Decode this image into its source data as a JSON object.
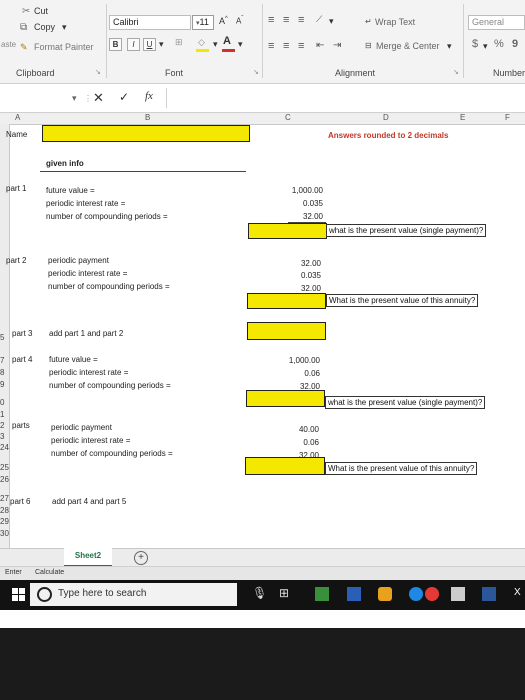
{
  "ribbon": {
    "cut": "Cut",
    "copy": "Copy",
    "paste_partial": "aste",
    "format_painter": "Format Painter",
    "font_name": "Calibri",
    "font_size": "11",
    "grow_font": "A",
    "shrink_font": "A",
    "bold": "B",
    "italic": "I",
    "underline": "U",
    "font_color": "A",
    "wrap_text": "Wrap Text",
    "merge_center": "Merge & Center",
    "number_format": "General",
    "currency": "$",
    "percent": "%",
    "comma": "9",
    "groups": {
      "clipboard": "Clipboard",
      "font": "Font",
      "alignment": "Alignment",
      "number": "Number"
    }
  },
  "formula_bar": {
    "fx": "fx"
  },
  "columns": [
    "A",
    "B",
    "C",
    "D",
    "E",
    "F"
  ],
  "rows": [
    "5",
    "7",
    "8",
    "9",
    "0",
    "1",
    "2",
    "3",
    "24",
    "25",
    "26",
    "27",
    "28",
    "29",
    "30"
  ],
  "sheet": {
    "name_label": "Name",
    "answers_note": "Answers rounded to 2 decimals",
    "given_info": "given info",
    "part1": {
      "label": "part 1",
      "fv_label": "future value =",
      "rate_label": "periodic interest rate =",
      "n_label": "number of compounding periods =",
      "fv": "1,000.00",
      "rate": "0.035",
      "n": "32.00",
      "question": "what is the present value (single payment)?"
    },
    "part2": {
      "label": "part 2",
      "pmt_label": "periodic payment",
      "rate_label": "periodic interest rate =",
      "n_label": "number of compounding periods =",
      "pmt": "32.00",
      "rate": "0.035",
      "n": "32.00",
      "question": "What is the present value of this annuity?"
    },
    "part3": {
      "label": "part 3",
      "text": "add part 1 and part 2"
    },
    "part4": {
      "label": "part 4",
      "fv_label": "future value =",
      "rate_label": "periodic interest rate =",
      "n_label": "number of compounding periods =",
      "fv": "1,000.00",
      "rate": "0.06",
      "n": "32.00",
      "question": "what is the present value (single payment)?"
    },
    "part5": {
      "label": "parts",
      "pmt_label": "periodic payment",
      "rate_label": "periodic interest rate =",
      "n_label": "number of compounding periods =",
      "pmt": "40.00",
      "rate": "0.06",
      "n": "32.00",
      "question": "What is the present value of this annuity?"
    },
    "part6": {
      "label": "part 6",
      "text": "add part 4 and part 5"
    }
  },
  "tabs": {
    "active": "Sheet2",
    "add": "+"
  },
  "status": {
    "mode": "Enter",
    "calc": "Calculate"
  },
  "taskbar": {
    "search_placeholder": "Type here to search"
  },
  "colors": {
    "highlight": "#f5e800",
    "accent_red": "#c0392b",
    "ribbon_bg": "#f3f3f3",
    "taskbar_bg": "#121212"
  }
}
